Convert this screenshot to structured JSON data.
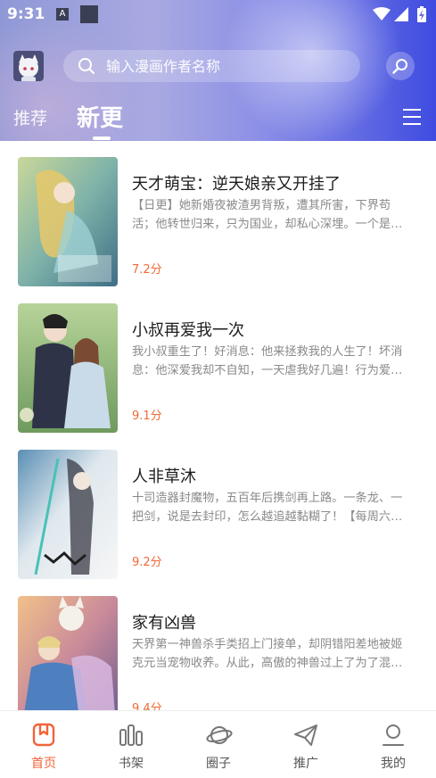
{
  "status_bar": {
    "time": "9:31",
    "a_icon": "A"
  },
  "search": {
    "placeholder": "输入漫画作者名称"
  },
  "tabs": [
    {
      "label": "推荐",
      "active": false
    },
    {
      "label": "新更",
      "active": true
    }
  ],
  "comics": [
    {
      "title": "天才萌宝：逆天娘亲又开挂了",
      "desc": "【日更】她新婚夜被渣男背叛，遭其所害，下界苟活；他转世归来，只为国业，却私心深埋。一个是…",
      "score": "7.2分"
    },
    {
      "title": "小叔再爱我一次",
      "desc": "我小叔重生了！好消息：他来拯救我的人生了！坏消息：他深爱我却不自知，一天虐我好几遍！行为爱…",
      "score": "9.1分"
    },
    {
      "title": "人非草沐",
      "desc": "十司造器封魔物，五百年后携剑再上路。一条龙、一把剑，说是去封印，怎么越追越黏糊了！【每周六…",
      "score": "9.2分"
    },
    {
      "title": "家有凶兽",
      "desc": "天界第一神兽杀手类招上门接单，却阴错阳差地被姬克元当宠物收养。从此，高傲的神兽过上了为了混…",
      "score": "9.4分"
    }
  ],
  "bottom_nav": [
    {
      "label": "首页",
      "icon": "bookmark-icon",
      "active": true
    },
    {
      "label": "书架",
      "icon": "bookshelf-icon",
      "active": false
    },
    {
      "label": "圈子",
      "icon": "planet-icon",
      "active": false
    },
    {
      "label": "推广",
      "icon": "paper-plane-icon",
      "active": false
    },
    {
      "label": "我的",
      "icon": "person-icon",
      "active": false
    }
  ],
  "colors": {
    "accent": "#f0643a",
    "score": "#f06a36",
    "header_start": "#8f98d6",
    "header_end": "#3f4ce0"
  }
}
